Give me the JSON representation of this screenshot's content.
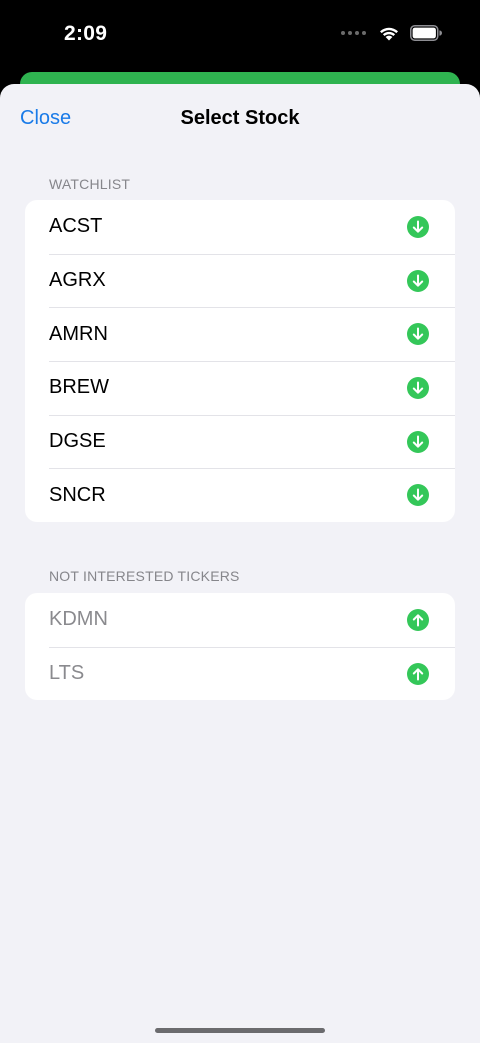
{
  "status_bar": {
    "time": "2:09"
  },
  "nav": {
    "close_label": "Close",
    "title": "Select Stock"
  },
  "watchlist": {
    "header": "WATCHLIST",
    "items": [
      {
        "ticker": "ACST",
        "action_icon": "arrow-down-circle-icon"
      },
      {
        "ticker": "AGRX",
        "action_icon": "arrow-down-circle-icon"
      },
      {
        "ticker": "AMRN",
        "action_icon": "arrow-down-circle-icon"
      },
      {
        "ticker": "BREW",
        "action_icon": "arrow-down-circle-icon"
      },
      {
        "ticker": "DGSE",
        "action_icon": "arrow-down-circle-icon"
      },
      {
        "ticker": "SNCR",
        "action_icon": "arrow-down-circle-icon"
      }
    ]
  },
  "not_interested": {
    "header": "NOT INTERESTED TICKERS",
    "items": [
      {
        "ticker": "KDMN",
        "action_icon": "arrow-up-circle-icon"
      },
      {
        "ticker": "LTS",
        "action_icon": "arrow-up-circle-icon"
      }
    ]
  },
  "colors": {
    "accent_blue": "#1a7be8",
    "action_green": "#34c759",
    "sheet_background": "#f2f2f7",
    "muted_text": "#8a8a8e"
  }
}
